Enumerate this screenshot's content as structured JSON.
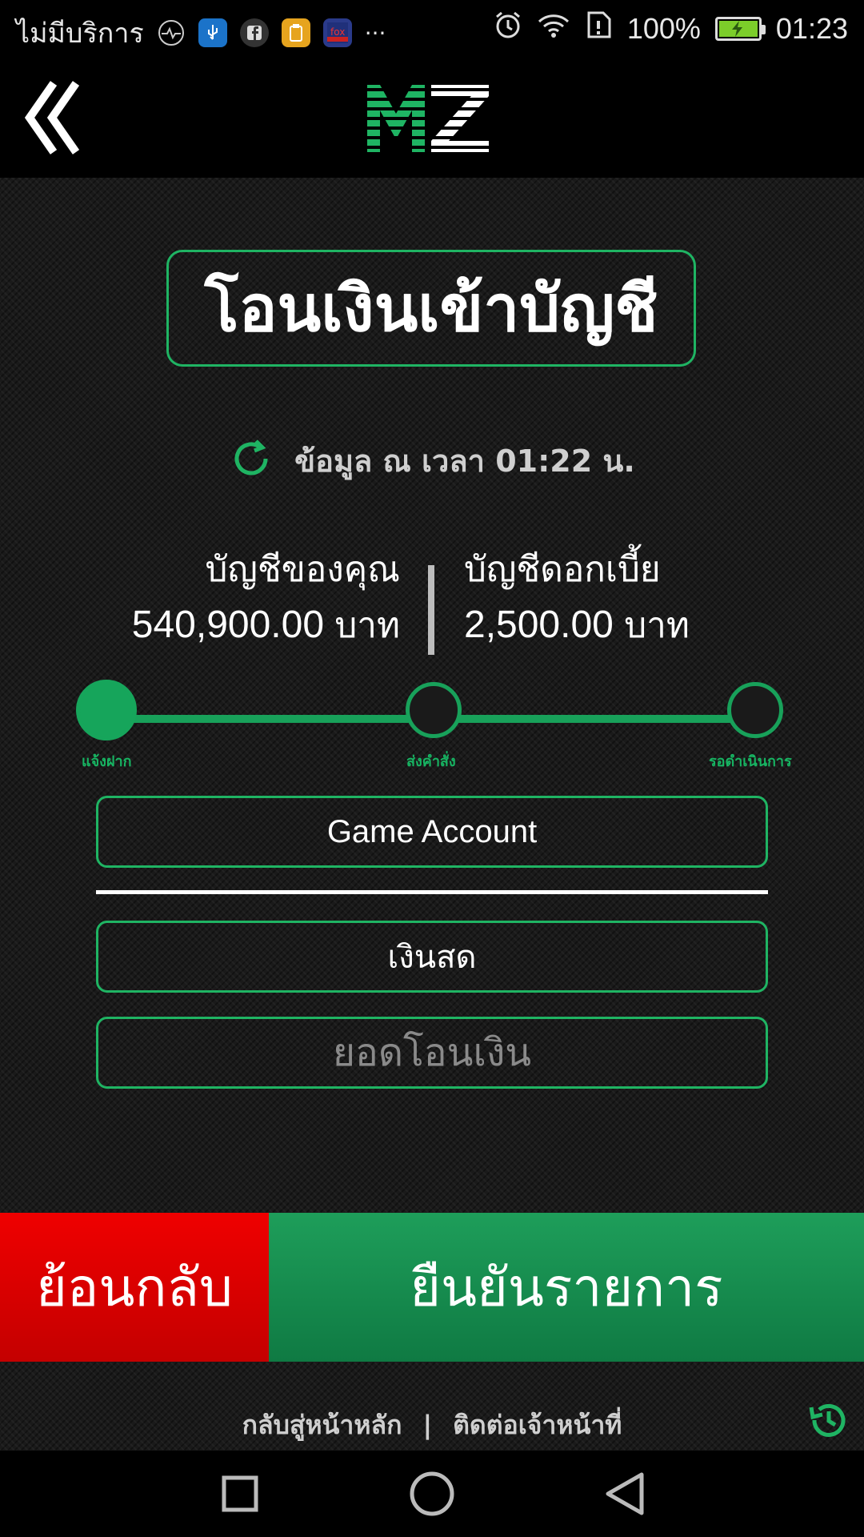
{
  "status_bar": {
    "carrier": "ไม่มีบริการ",
    "more": "···",
    "battery": "100%",
    "battery_level": 1.0,
    "time": "01:23",
    "icons": [
      "pulse-icon",
      "usb-icon",
      "facebook-icon",
      "clipboard-icon",
      "app-icon",
      "alarm-icon",
      "wifi-icon",
      "sim-alert-icon",
      "battery-charging-icon"
    ]
  },
  "header": {
    "logo_text": "MZ",
    "back_icon": "double-chevron-left-icon"
  },
  "page": {
    "title": "โอนเงินเข้าบัญชี",
    "timestamp": "ข้อมูล ณ เวลา 01:22 น.",
    "refresh_icon": "refresh-icon"
  },
  "balances": {
    "mine_label": "บัญชีของคุณ",
    "mine_value": "540,900.00",
    "interest_label": "บัญชีดอกเบี้ย",
    "interest_value": "2,500.00",
    "unit": "บาท"
  },
  "steps": [
    {
      "label": "แจ้งฝาก",
      "active": true
    },
    {
      "label": "ส่งคำสั่ง",
      "active": false
    },
    {
      "label": "รอดำเนินการ",
      "active": false
    }
  ],
  "form": {
    "account": "Game Account",
    "method": "เงินสด",
    "amount_placeholder": "ยอดโอนเงิน",
    "amount_value": ""
  },
  "actions": {
    "back": "ย้อนกลับ",
    "confirm": "ยืนยันรายการ"
  },
  "footer": {
    "home": "กลับสู่หน้าหลัก",
    "separator": "|",
    "contact": "ติดต่อเจ้าหน้าที่",
    "history_icon": "history-icon"
  },
  "colors": {
    "accent_green": "#1fb463",
    "danger_red": "#e00000",
    "confirm_green": "#168d50",
    "background": "#1a1a1a"
  }
}
